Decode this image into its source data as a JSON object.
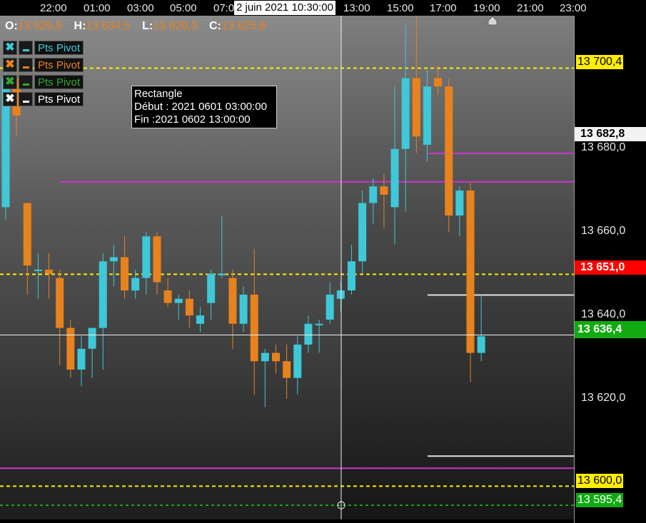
{
  "time_axis": {
    "labels": [
      "22:00",
      "01:00",
      "03:00",
      "05:00",
      "07:0",
      "13:00",
      "15:00",
      "17:00",
      "19:00",
      "21:00",
      "23:00"
    ],
    "cursor_label": "2 juin 2021 10:30:00"
  },
  "ohlc": {
    "o_key": "O:",
    "o_val": "13 629,9",
    "h_key": "H:",
    "h_val": "13 634,5",
    "l_key": "L:",
    "l_val": "13 620,3",
    "c_key": "C:",
    "c_val": "13 625,8"
  },
  "legend": [
    {
      "x_glyph": "✖",
      "label": "Pts Pivot",
      "color": "#3ec8d8",
      "x_color": "#3ec8d8"
    },
    {
      "x_glyph": "✖",
      "label": "Pts Pivot",
      "color": "#e8821e",
      "x_color": "#e8821e"
    },
    {
      "x_glyph": "✖",
      "label": "Pts Pivot",
      "color": "#2fa82f",
      "x_color": "#2fa82f"
    },
    {
      "x_glyph": "✖",
      "label": "Pts Pivot",
      "color": "#ffffff",
      "x_color": "#ffffff"
    }
  ],
  "tooltip": {
    "title": "Rectangle",
    "start": "Début : 2021 0601 03:00:00",
    "end": "Fin :2021 0602 13:00:00"
  },
  "price_axis": {
    "ticks": [
      "13 680,0",
      "13 660,0",
      "13 640,0",
      "13 620,0"
    ],
    "tags": {
      "pivot_high": "13 700,4",
      "crosshair": "13 682,8",
      "red_level": "13 651,0",
      "last_price": "13 636,4",
      "pivot_low": "13 600,0",
      "green_level": "13 595,4"
    },
    "colors": {
      "yellow": "#ffee00",
      "red": "#ff0000",
      "green": "#11aa11",
      "cyan": "#3ec8d8",
      "orange": "#e8821e",
      "magenta": "#cc33cc"
    }
  },
  "chart_data": {
    "type": "candlestick",
    "y_range": [
      13592,
      13713
    ],
    "levels": {
      "yellow_top": 13700.4,
      "yellow_mid": 13650.9,
      "yellow_low": 13600.0,
      "green_dashed": 13595.4,
      "magenta_1": 13679.9,
      "magenta_2": 13673.1,
      "magenta_3": 13604.3,
      "white_1": 13645.9,
      "white_2": 13607.2,
      "crosshair_h": 13636.3
    },
    "candles": [
      {
        "o": 13667,
        "h": 13706,
        "l": 13664,
        "c": 13698
      },
      {
        "o": 13698,
        "h": 13704,
        "l": 13684,
        "c": 13689
      },
      {
        "o": 13668,
        "h": 13668,
        "l": 13646,
        "c": 13653
      },
      {
        "o": 13652,
        "h": 13656,
        "l": 13645,
        "c": 13652
      },
      {
        "o": 13652,
        "h": 13656,
        "l": 13645,
        "c": 13651
      },
      {
        "o": 13650,
        "h": 13652,
        "l": 13629,
        "c": 13638
      },
      {
        "o": 13638,
        "h": 13640,
        "l": 13626,
        "c": 13628
      },
      {
        "o": 13628,
        "h": 13636,
        "l": 13624,
        "c": 13633
      },
      {
        "o": 13633,
        "h": 13638,
        "l": 13626,
        "c": 13638
      },
      {
        "o": 13638,
        "h": 13656,
        "l": 13628,
        "c": 13654
      },
      {
        "o": 13654,
        "h": 13658,
        "l": 13648,
        "c": 13655
      },
      {
        "o": 13655,
        "h": 13660,
        "l": 13645,
        "c": 13647
      },
      {
        "o": 13647,
        "h": 13652,
        "l": 13645,
        "c": 13650
      },
      {
        "o": 13650,
        "h": 13661,
        "l": 13646,
        "c": 13660
      },
      {
        "o": 13660,
        "h": 13661,
        "l": 13646,
        "c": 13649
      },
      {
        "o": 13647,
        "h": 13650,
        "l": 13643,
        "c": 13644
      },
      {
        "o": 13644,
        "h": 13646,
        "l": 13640,
        "c": 13645
      },
      {
        "o": 13645,
        "h": 13647,
        "l": 13638,
        "c": 13641
      },
      {
        "o": 13639,
        "h": 13643,
        "l": 13637,
        "c": 13641
      },
      {
        "o": 13644,
        "h": 13652,
        "l": 13640,
        "c": 13651
      },
      {
        "o": 13651,
        "h": 13665,
        "l": 13650,
        "c": 13651
      },
      {
        "o": 13650,
        "h": 13652,
        "l": 13633,
        "c": 13639
      },
      {
        "o": 13639,
        "h": 13648,
        "l": 13637,
        "c": 13646
      },
      {
        "o": 13646,
        "h": 13657,
        "l": 13622,
        "c": 13630
      },
      {
        "o": 13630,
        "h": 13633,
        "l": 13619,
        "c": 13632
      },
      {
        "o": 13632,
        "h": 13634,
        "l": 13627,
        "c": 13630
      },
      {
        "o": 13630,
        "h": 13634,
        "l": 13621,
        "c": 13626
      },
      {
        "o": 13626,
        "h": 13636,
        "l": 13622,
        "c": 13634
      },
      {
        "o": 13634,
        "h": 13641,
        "l": 13632,
        "c": 13639
      },
      {
        "o": 13639,
        "h": 13640,
        "l": 13632,
        "c": 13639
      },
      {
        "o": 13640,
        "h": 13649,
        "l": 13639,
        "c": 13646
      },
      {
        "o": 13645,
        "h": 13649,
        "l": 13642,
        "c": 13647
      },
      {
        "o": 13647,
        "h": 13658,
        "l": 13646,
        "c": 13654
      },
      {
        "o": 13654,
        "h": 13671,
        "l": 13651,
        "c": 13668
      },
      {
        "o": 13668,
        "h": 13674,
        "l": 13663,
        "c": 13672
      },
      {
        "o": 13672,
        "h": 13675,
        "l": 13662,
        "c": 13670
      },
      {
        "o": 13667,
        "h": 13696,
        "l": 13658,
        "c": 13681
      },
      {
        "o": 13681,
        "h": 13711,
        "l": 13666,
        "c": 13698
      },
      {
        "o": 13698,
        "h": 13713,
        "l": 13680,
        "c": 13684
      },
      {
        "o": 13682,
        "h": 13700,
        "l": 13678,
        "c": 13696
      },
      {
        "o": 13698,
        "h": 13701,
        "l": 13694,
        "c": 13696
      },
      {
        "o": 13696,
        "h": 13698,
        "l": 13661,
        "c": 13665
      },
      {
        "o": 13665,
        "h": 13672,
        "l": 13660,
        "c": 13671
      },
      {
        "o": 13671,
        "h": 13673,
        "l": 13625,
        "c": 13632
      },
      {
        "o": 13632,
        "h": 13646,
        "l": 13630,
        "c": 13636
      }
    ]
  }
}
